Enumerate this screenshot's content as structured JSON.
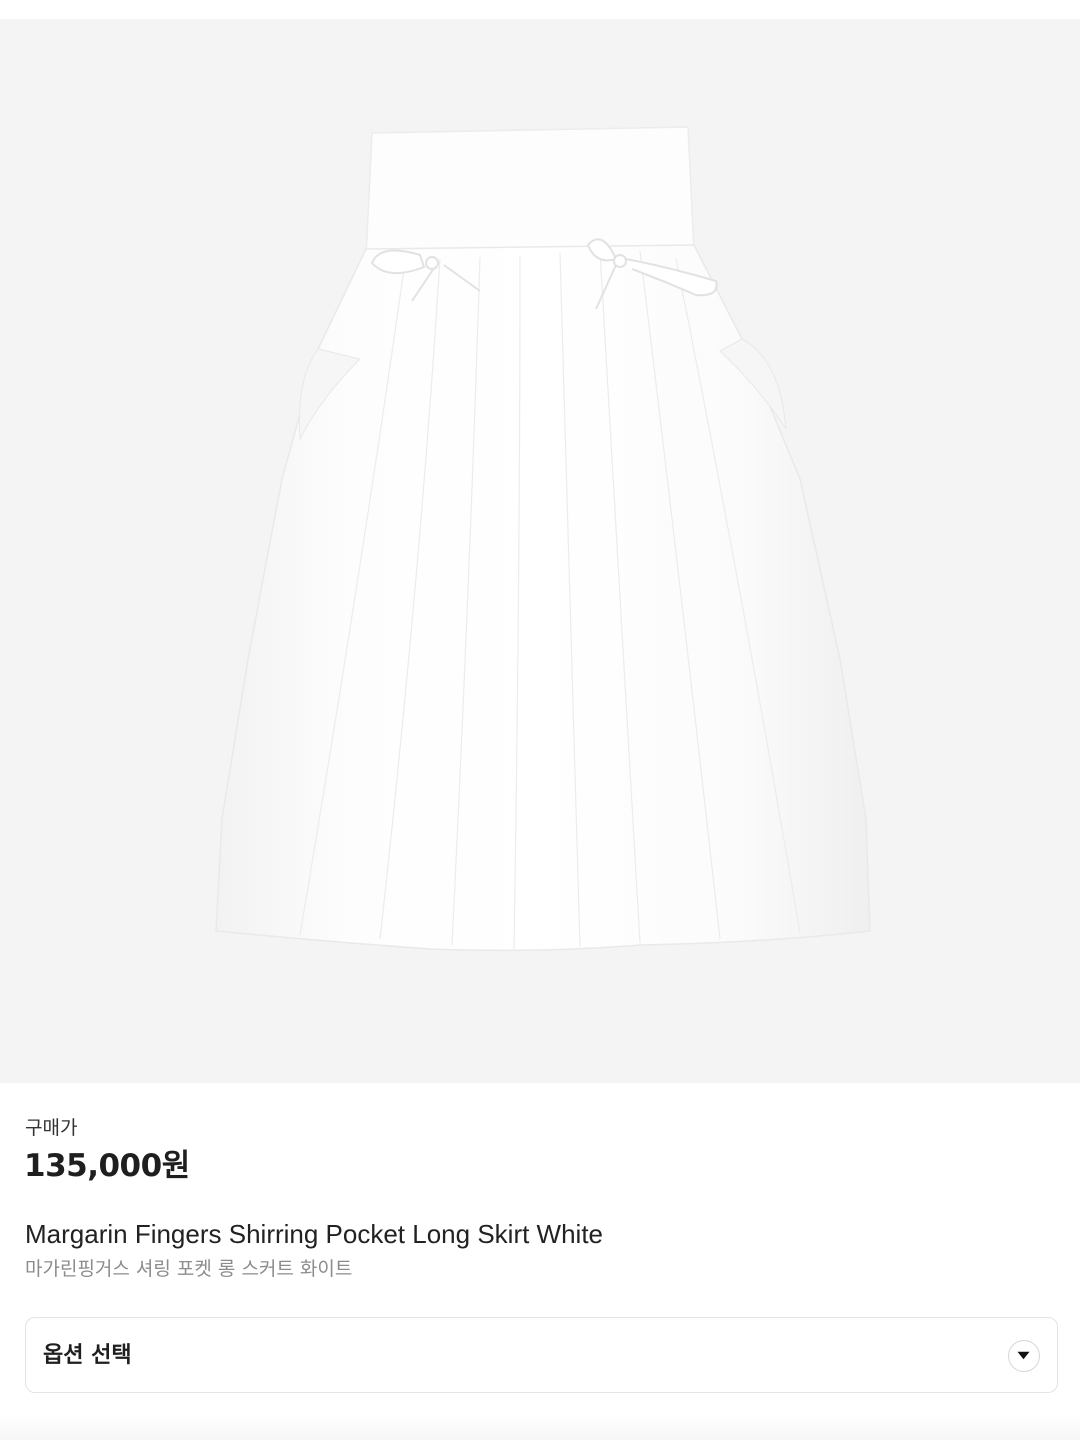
{
  "product": {
    "image_alt": "Margarin Fingers Shirring Pocket Long Skirt White",
    "price_label": "구매가",
    "price": "135,000원",
    "name": "Margarin Fingers Shirring Pocket Long Skirt White",
    "name_kr": "마가린핑거스 셔링 포켓 롱 스커트 화이트"
  },
  "options": {
    "select_label": "옵션 선택",
    "chevron_icon": "chevron-down-icon"
  },
  "colors": {
    "image_background": "#f4f4f4",
    "price_text": "#1f1f1f",
    "subtext": "#8c8c8c",
    "border": "#e4e4e4"
  }
}
